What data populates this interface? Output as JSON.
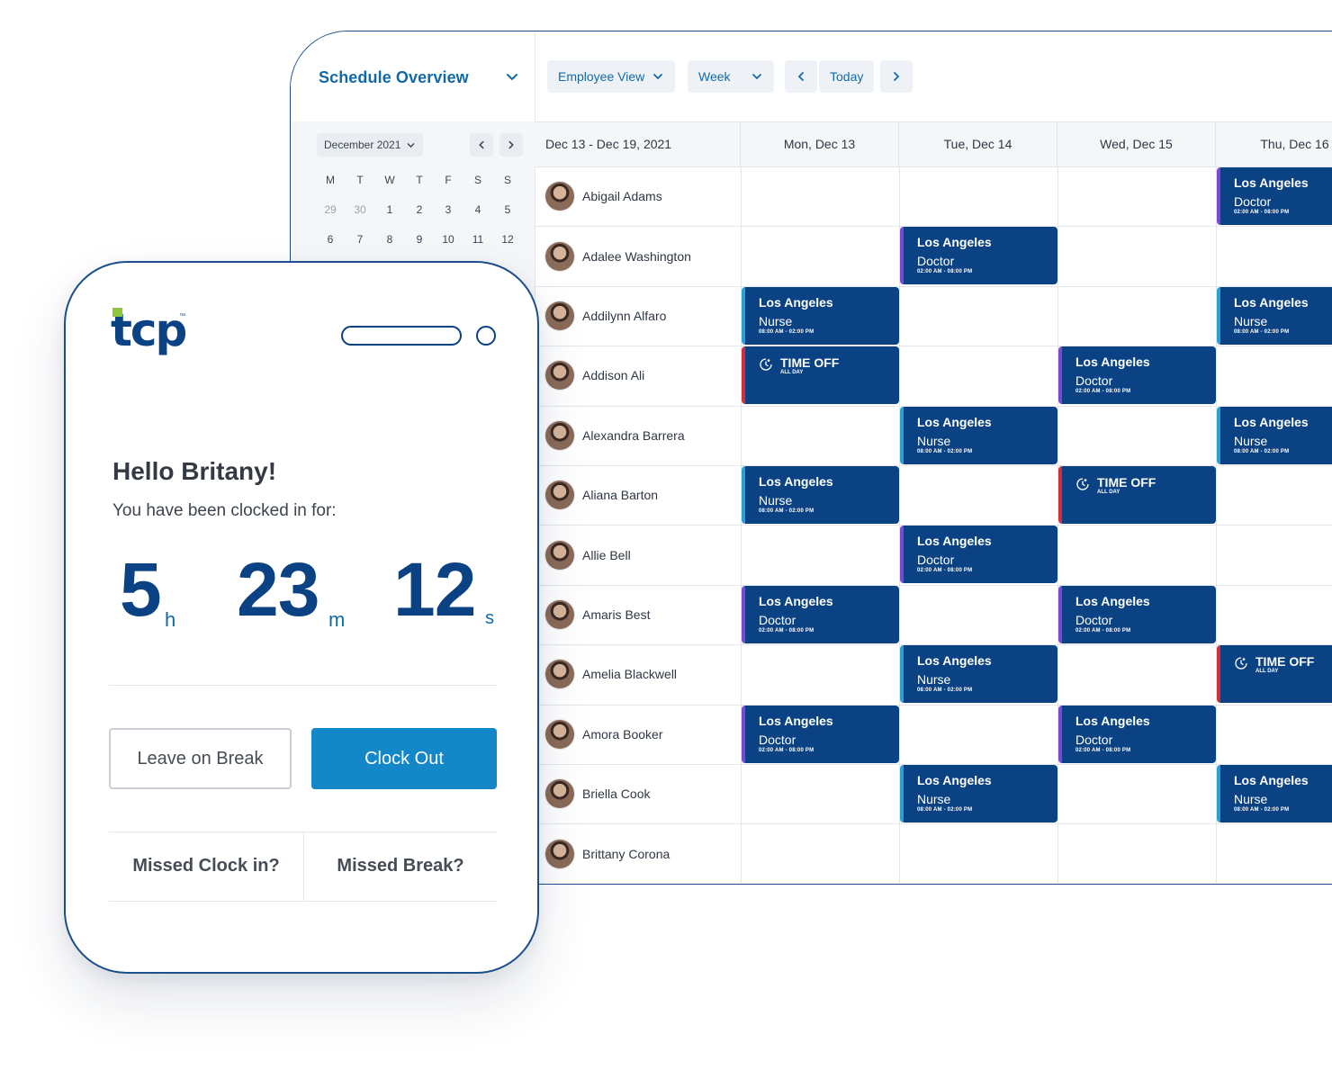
{
  "schedule": {
    "title": "Schedule Overview",
    "view_label": "Employee View",
    "range_label": "Week",
    "today_label": "Today",
    "mini_cal": {
      "month": "December 2021",
      "weekdays": [
        "M",
        "T",
        "W",
        "T",
        "F",
        "S",
        "S"
      ],
      "week1": [
        "29",
        "30",
        "1",
        "2",
        "3",
        "4",
        "5"
      ],
      "week2": [
        "6",
        "7",
        "8",
        "9",
        "10",
        "11",
        "12"
      ]
    },
    "date_range": "Dec 13 - Dec 19, 2021",
    "days": [
      "Mon, Dec 13",
      "Tue, Dec 14",
      "Wed, Dec 15",
      "Thu, Dec 16"
    ],
    "employees": [
      "Abigail Adams",
      "Adalee Washington",
      "Addilynn Alfaro",
      "Addison Ali",
      "Alexandra Barrera",
      "Aliana Barton",
      "Allie Bell",
      "Amaris Best",
      "Amelia Blackwell",
      "Amora Booker",
      "Briella Cook",
      "Brittany Corona"
    ],
    "shift_text": {
      "location": "Los Angeles",
      "nurse": "Nurse",
      "doctor": "Doctor",
      "nurse_time": "08:00 AM - 02:00 PM",
      "doctor_time": "02:00 AM - 08:00 PM",
      "time_off": "TIME OFF",
      "all_day": "ALL DAY"
    },
    "shifts": [
      {
        "row": 0,
        "day": 3,
        "kind": "doctor"
      },
      {
        "row": 1,
        "day": 1,
        "kind": "doctor"
      },
      {
        "row": 2,
        "day": 0,
        "kind": "nurse"
      },
      {
        "row": 2,
        "day": 3,
        "kind": "nurse"
      },
      {
        "row": 3,
        "day": 0,
        "kind": "timeoff"
      },
      {
        "row": 3,
        "day": 2,
        "kind": "doctor"
      },
      {
        "row": 4,
        "day": 1,
        "kind": "nurse"
      },
      {
        "row": 4,
        "day": 3,
        "kind": "nurse"
      },
      {
        "row": 5,
        "day": 0,
        "kind": "nurse"
      },
      {
        "row": 5,
        "day": 2,
        "kind": "timeoff"
      },
      {
        "row": 6,
        "day": 1,
        "kind": "doctor"
      },
      {
        "row": 7,
        "day": 0,
        "kind": "doctor"
      },
      {
        "row": 7,
        "day": 2,
        "kind": "doctor"
      },
      {
        "row": 8,
        "day": 1,
        "kind": "nurse"
      },
      {
        "row": 8,
        "day": 3,
        "kind": "timeoff"
      },
      {
        "row": 9,
        "day": 0,
        "kind": "doctor"
      },
      {
        "row": 9,
        "day": 2,
        "kind": "doctor"
      },
      {
        "row": 10,
        "day": 1,
        "kind": "nurse"
      },
      {
        "row": 10,
        "day": 3,
        "kind": "nurse"
      }
    ]
  },
  "phone": {
    "logo_text": "tcp",
    "logo_tm": "™",
    "greeting": "Hello Britany!",
    "subtitle": "You have been clocked in for:",
    "hours": "5",
    "hours_unit": "h",
    "minutes": "23",
    "minutes_unit": "m",
    "seconds": "12",
    "seconds_unit": "s",
    "break_label": "Leave on Break",
    "clockout_label": "Clock Out",
    "missed_clock_label": "Missed Clock in?",
    "missed_break_label": "Missed Break?"
  },
  "colors": {
    "brand_blue": "#0a4283",
    "accent_blue": "#1487c8",
    "nurse_stripe": "#2aa0d8",
    "doctor_stripe": "#7a48d1",
    "timeoff_stripe": "#d12f3e",
    "logo_green": "#8cc63f"
  }
}
